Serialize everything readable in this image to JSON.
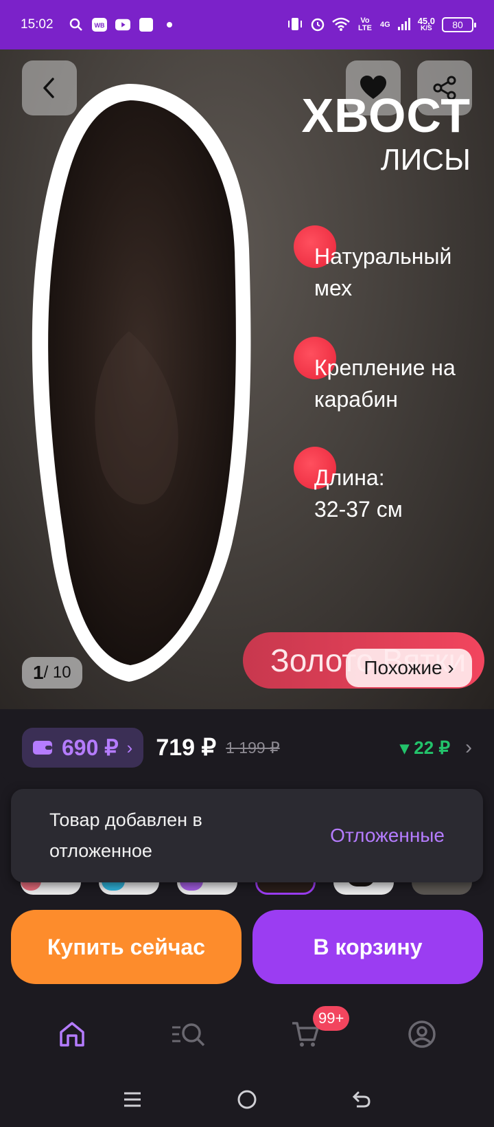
{
  "status_bar": {
    "time": "15:02",
    "left_icons": [
      "search-icon",
      "wb-app-icon",
      "youtube-icon",
      "square-app-icon",
      "dot-icon"
    ],
    "volte_label": "Vo LTE",
    "network": "4G",
    "speed_value": "45,0",
    "speed_unit": "K/S",
    "battery": "80"
  },
  "hero": {
    "title": "ХВОСТ",
    "subtitle": "ЛИСЫ",
    "features": [
      {
        "text": "Натуральный\nмех"
      },
      {
        "text": "Крепление на\nкарабин"
      },
      {
        "text": "Длина:\n32-37 см"
      }
    ],
    "brand_pill": "Золото Вятки",
    "similar_label": "Похожие ›",
    "counter_current": "1",
    "counter_total": "/ 10"
  },
  "price_bar": {
    "wallet_price": "690 ₽",
    "price": "719 ₽",
    "old_price": "1 199 ₽",
    "cashback": "▾ 22 ₽"
  },
  "toast": {
    "message": "Товар добавлен в отложенное",
    "link": "Отложенные"
  },
  "actions": {
    "buy_now": "Купить сейчас",
    "add_to_cart": "В корзину"
  },
  "bottom_nav": {
    "items": [
      "home-icon",
      "catalog-search-icon",
      "cart-icon",
      "profile-icon"
    ],
    "cart_badge": "99+"
  },
  "colors": {
    "brand_purple": "#7b22c9",
    "accent_purple": "#9b3df2",
    "orange": "#fd8c2c",
    "cashback_green": "#23c36b",
    "feature_red": "#f2455e"
  }
}
